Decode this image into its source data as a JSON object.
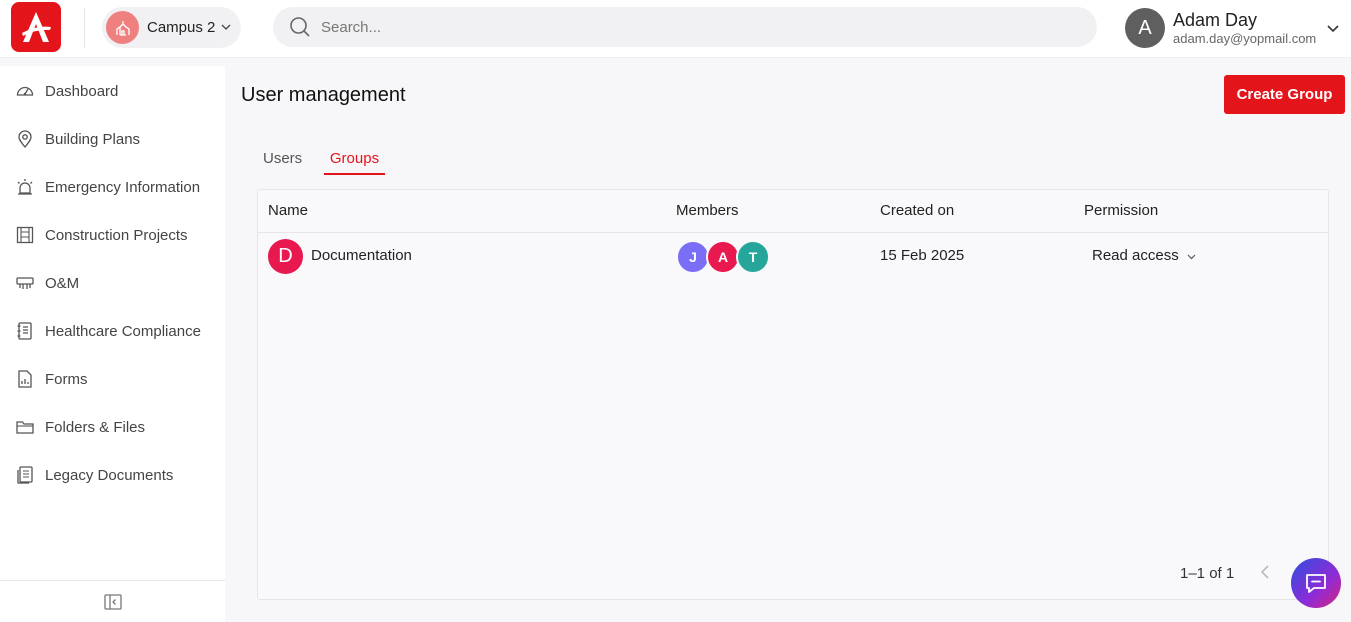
{
  "header": {
    "campus": {
      "name": "Campus 2",
      "icon": "building-icon"
    },
    "search": {
      "placeholder": "Search..."
    },
    "user": {
      "initial": "A",
      "name": "Adam Day",
      "email": "adam.day@yopmail.com"
    }
  },
  "sidebar": {
    "items": [
      {
        "label": "Dashboard",
        "icon": "speedometer-icon"
      },
      {
        "label": "Building Plans",
        "icon": "map-pin-icon"
      },
      {
        "label": "Emergency Information",
        "icon": "alarm-icon"
      },
      {
        "label": "Construction Projects",
        "icon": "construction-icon"
      },
      {
        "label": "O&M",
        "icon": "hvac-icon"
      },
      {
        "label": "Healthcare Compliance",
        "icon": "notebook-icon"
      },
      {
        "label": "Forms",
        "icon": "form-icon"
      },
      {
        "label": "Folders & Files",
        "icon": "folder-icon"
      },
      {
        "label": "Legacy Documents",
        "icon": "documents-icon"
      }
    ]
  },
  "main": {
    "title": "User management",
    "create_button": "Create Group",
    "tabs": [
      {
        "label": "Users",
        "active": false
      },
      {
        "label": "Groups",
        "active": true
      }
    ],
    "table": {
      "columns": [
        "Name",
        "Members",
        "Created on",
        "Permission"
      ],
      "rows": [
        {
          "initial": "D",
          "name": "Documentation",
          "members": [
            {
              "initial": "J",
              "color": "#7b6ef6"
            },
            {
              "initial": "A",
              "color": "#e8194f"
            },
            {
              "initial": "T",
              "color": "#26a69a"
            }
          ],
          "created_on": "15 Feb 2025",
          "permission": "Read access"
        }
      ],
      "pagination": "1–1 of 1"
    }
  },
  "colors": {
    "accent": "#e4141b",
    "group_avatar": "#e8194f"
  }
}
